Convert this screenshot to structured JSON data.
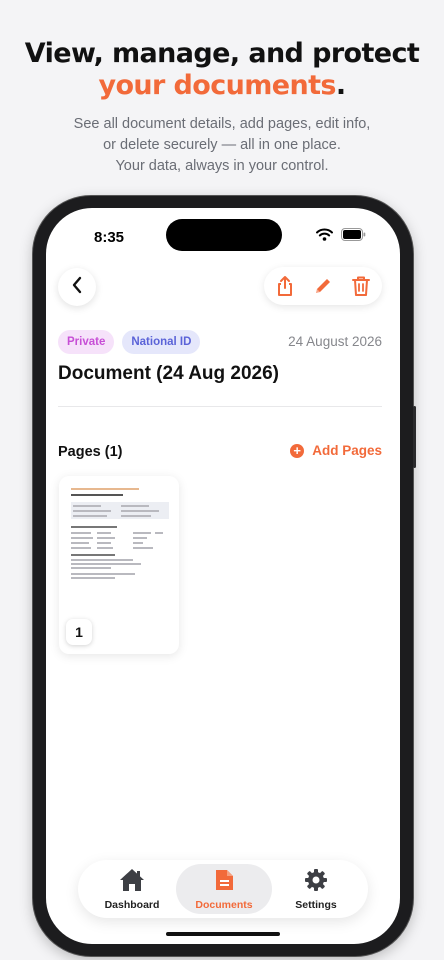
{
  "hero": {
    "title_line1": "View, manage, and protect",
    "title_accent": "your documents",
    "title_period": ".",
    "desc_line1": "See all document details, add pages, edit info,",
    "desc_line2": "or delete securely — all in one place.",
    "desc_line3": "Your data, always in your control."
  },
  "status": {
    "time": "8:35"
  },
  "header": {
    "back_icon": "chevron-left-icon",
    "actions": [
      "share-icon",
      "edit-icon",
      "trash-icon"
    ]
  },
  "document": {
    "tags": [
      "Private",
      "National ID"
    ],
    "date": "24 August 2026",
    "title": "Document (24 Aug 2026)"
  },
  "pages": {
    "title": "Pages (1)",
    "add_label": "Add Pages",
    "items": [
      {
        "number": "1"
      }
    ]
  },
  "tabbar": {
    "items": [
      {
        "label": "Dashboard",
        "icon": "home-icon"
      },
      {
        "label": "Documents",
        "icon": "document-icon"
      },
      {
        "label": "Settings",
        "icon": "gear-icon"
      }
    ],
    "active": "Documents"
  },
  "colors": {
    "accent": "#f26a3a",
    "private_tag": "#c74fd6",
    "national_id_tag": "#5b63d8"
  }
}
